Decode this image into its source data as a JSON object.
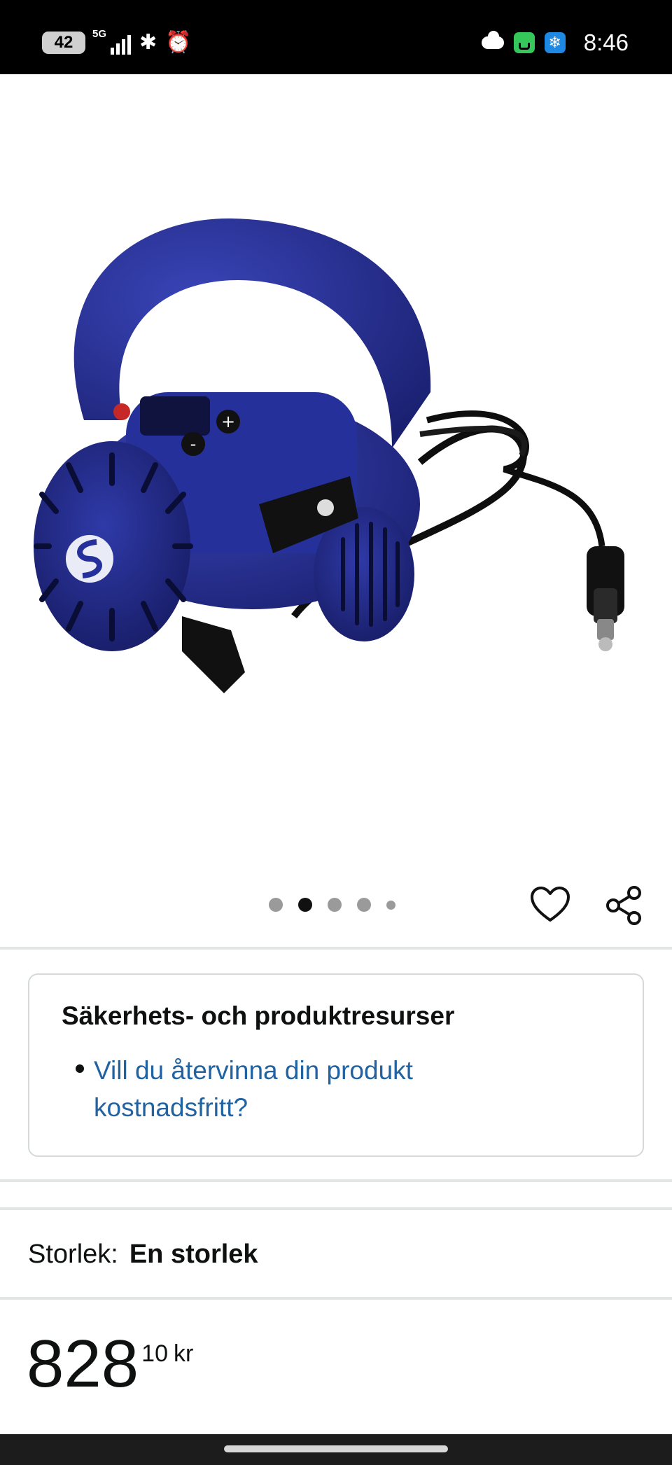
{
  "status_bar": {
    "battery": "42",
    "network": "5G",
    "time": "8:46"
  },
  "carousel": {
    "dot_count": 5,
    "active_index": 1
  },
  "safety": {
    "title": "Säkerhets- och produktresurser",
    "link_text": "Vill du återvinna din produkt kostnadsfritt?"
  },
  "size": {
    "label": "Storlek:",
    "value": "En storlek"
  },
  "price": {
    "whole": "828",
    "fraction": "10",
    "currency": "kr"
  },
  "colors": {
    "link": "#2162a1",
    "pump_body": "#26309a",
    "divider": "#e3e6e6"
  }
}
